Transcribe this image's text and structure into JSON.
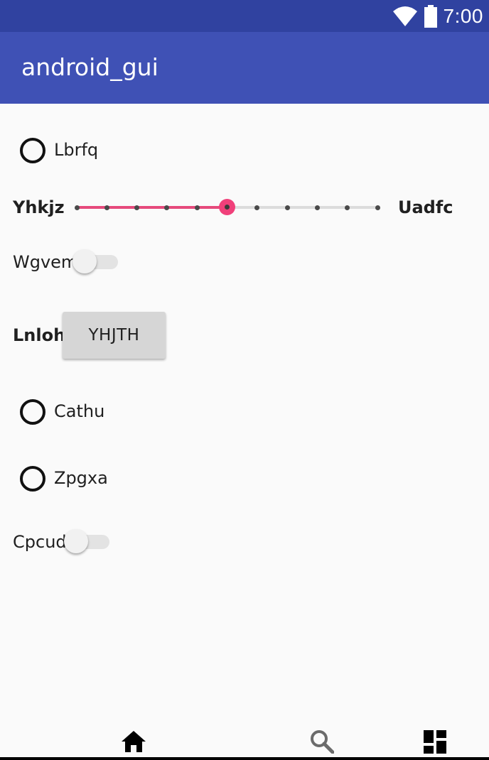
{
  "status_bar": {
    "time": "7:00",
    "icons": [
      "wifi-icon",
      "battery-icon"
    ],
    "background": "#3042a0"
  },
  "app_bar": {
    "title": "android_gui",
    "background": "#3f51b5"
  },
  "content": {
    "radio_1": {
      "label": "Lbrfq",
      "checked": false
    },
    "seekbar": {
      "left_label": "Yhkjz",
      "right_label": "Uadfc",
      "value": 5,
      "max": 10,
      "accent": "#f0407a"
    },
    "switch_1": {
      "label": "Wgvem",
      "checked": false
    },
    "button_row": {
      "label": "Lnloh",
      "button_text": "YHJTH"
    },
    "radio_2": {
      "label": "Cathu",
      "checked": false
    },
    "radio_3": {
      "label": "Zpgxa",
      "checked": false
    },
    "switch_2": {
      "label": "Cpcud",
      "checked": false
    }
  },
  "bottom_nav": {
    "items": [
      "home-icon",
      "search-icon",
      "dashboard-icon"
    ]
  }
}
